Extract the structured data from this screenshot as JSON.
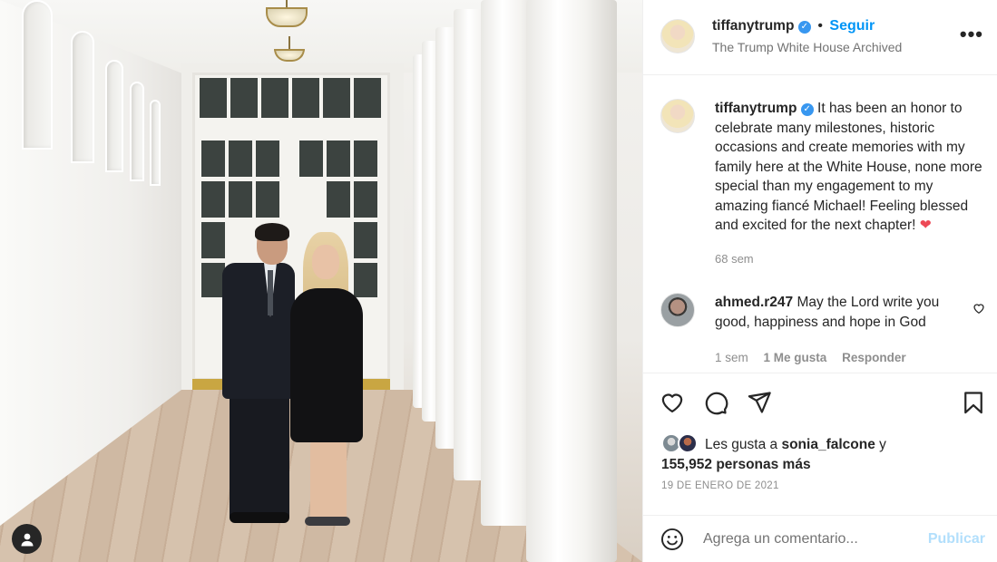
{
  "post_image": {
    "alt": "",
    "account_button_icon": "user-silhouette-icon"
  },
  "header": {
    "username": "tiffanytrump",
    "verified_icon": "verified-badge-icon",
    "separator": "•",
    "follow_label": "Seguir",
    "location": "The Trump White House Archived",
    "more_icon": "more-horizontal-icon"
  },
  "caption": {
    "username": "tiffanytrump",
    "text": "It has been an honor to celebrate many milestones, historic occasions and create memories with my family here at the White House, none more special than my engagement to my amazing fiancé Michael! Feeling blessed and excited for the next chapter!",
    "emoji": "❤",
    "time_ago": "68 sem"
  },
  "comments": [
    {
      "username": "ahmed.r247",
      "text": "May the Lord write you good, happiness and hope in God",
      "time_ago": "1 sem",
      "likes_label": "1 Me gusta",
      "reply_label": "Responder"
    }
  ],
  "actions": {
    "like_icon": "heart-icon",
    "comment_icon": "comment-icon",
    "share_icon": "send-icon",
    "save_icon": "bookmark-icon"
  },
  "likes": {
    "prefix": "Les gusta a",
    "first_user": "sonia_falcone",
    "conjunction": "y",
    "count_text": "155,952 personas más"
  },
  "date": "19 DE ENERO DE 2021",
  "comment_box": {
    "emoji_icon": "smiley-icon",
    "placeholder": "Agrega un comentario...",
    "publish_label": "Publicar"
  },
  "colors": {
    "link_blue": "#0095f6",
    "publish_disabled": "#b2dffc",
    "heart_red": "#ed4956",
    "verified_blue": "#3897f0"
  }
}
